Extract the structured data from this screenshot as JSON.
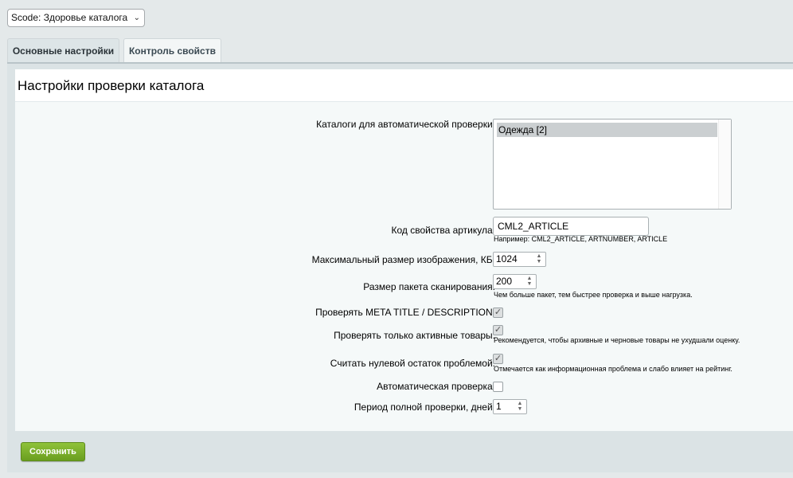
{
  "site_select": {
    "value": "Scode: Здоровье каталога"
  },
  "tabs": [
    {
      "label": "Основные настройки",
      "active": true
    },
    {
      "label": "Контроль свойств",
      "active": false
    }
  ],
  "panel": {
    "title": "Настройки проверки каталога"
  },
  "form": {
    "catalogs": {
      "label": "Каталоги для автоматической проверки:",
      "options": [
        "Одежда [2]"
      ]
    },
    "article_code": {
      "label": "Код свойства артикула:",
      "value": "CML2_ARTICLE",
      "hint": "Например: CML2_ARTICLE, ARTNUMBER, ARTICLE"
    },
    "max_image_size": {
      "label": "Максимальный размер изображения, КБ:",
      "value": "1024"
    },
    "scan_batch": {
      "label": "Размер пакета сканирования:",
      "value": "200",
      "hint": "Чем больше пакет, тем быстрее проверка и выше нагрузка."
    },
    "check_meta": {
      "label": "Проверять META TITLE / DESCRIPTION:",
      "checked": true
    },
    "active_only": {
      "label": "Проверять только активные товары:",
      "checked": true,
      "hint": "Рекомендуется, чтобы архивные и черновые товары не ухудшали оценку."
    },
    "zero_stock": {
      "label": "Считать нулевой остаток проблемой:",
      "checked": true,
      "hint": "Отмечается как информационная проблема и слабо влияет на рейтинг."
    },
    "auto_check": {
      "label": "Автоматическая проверка:",
      "checked": false
    },
    "full_period": {
      "label": "Период полной проверки, дней:",
      "value": "1"
    }
  },
  "actions": {
    "save_label": "Сохранить"
  },
  "colors": {
    "accent_green": "#7bb12b",
    "panel_bg": "#dbe3e5",
    "form_bg": "#f5f9f9"
  }
}
